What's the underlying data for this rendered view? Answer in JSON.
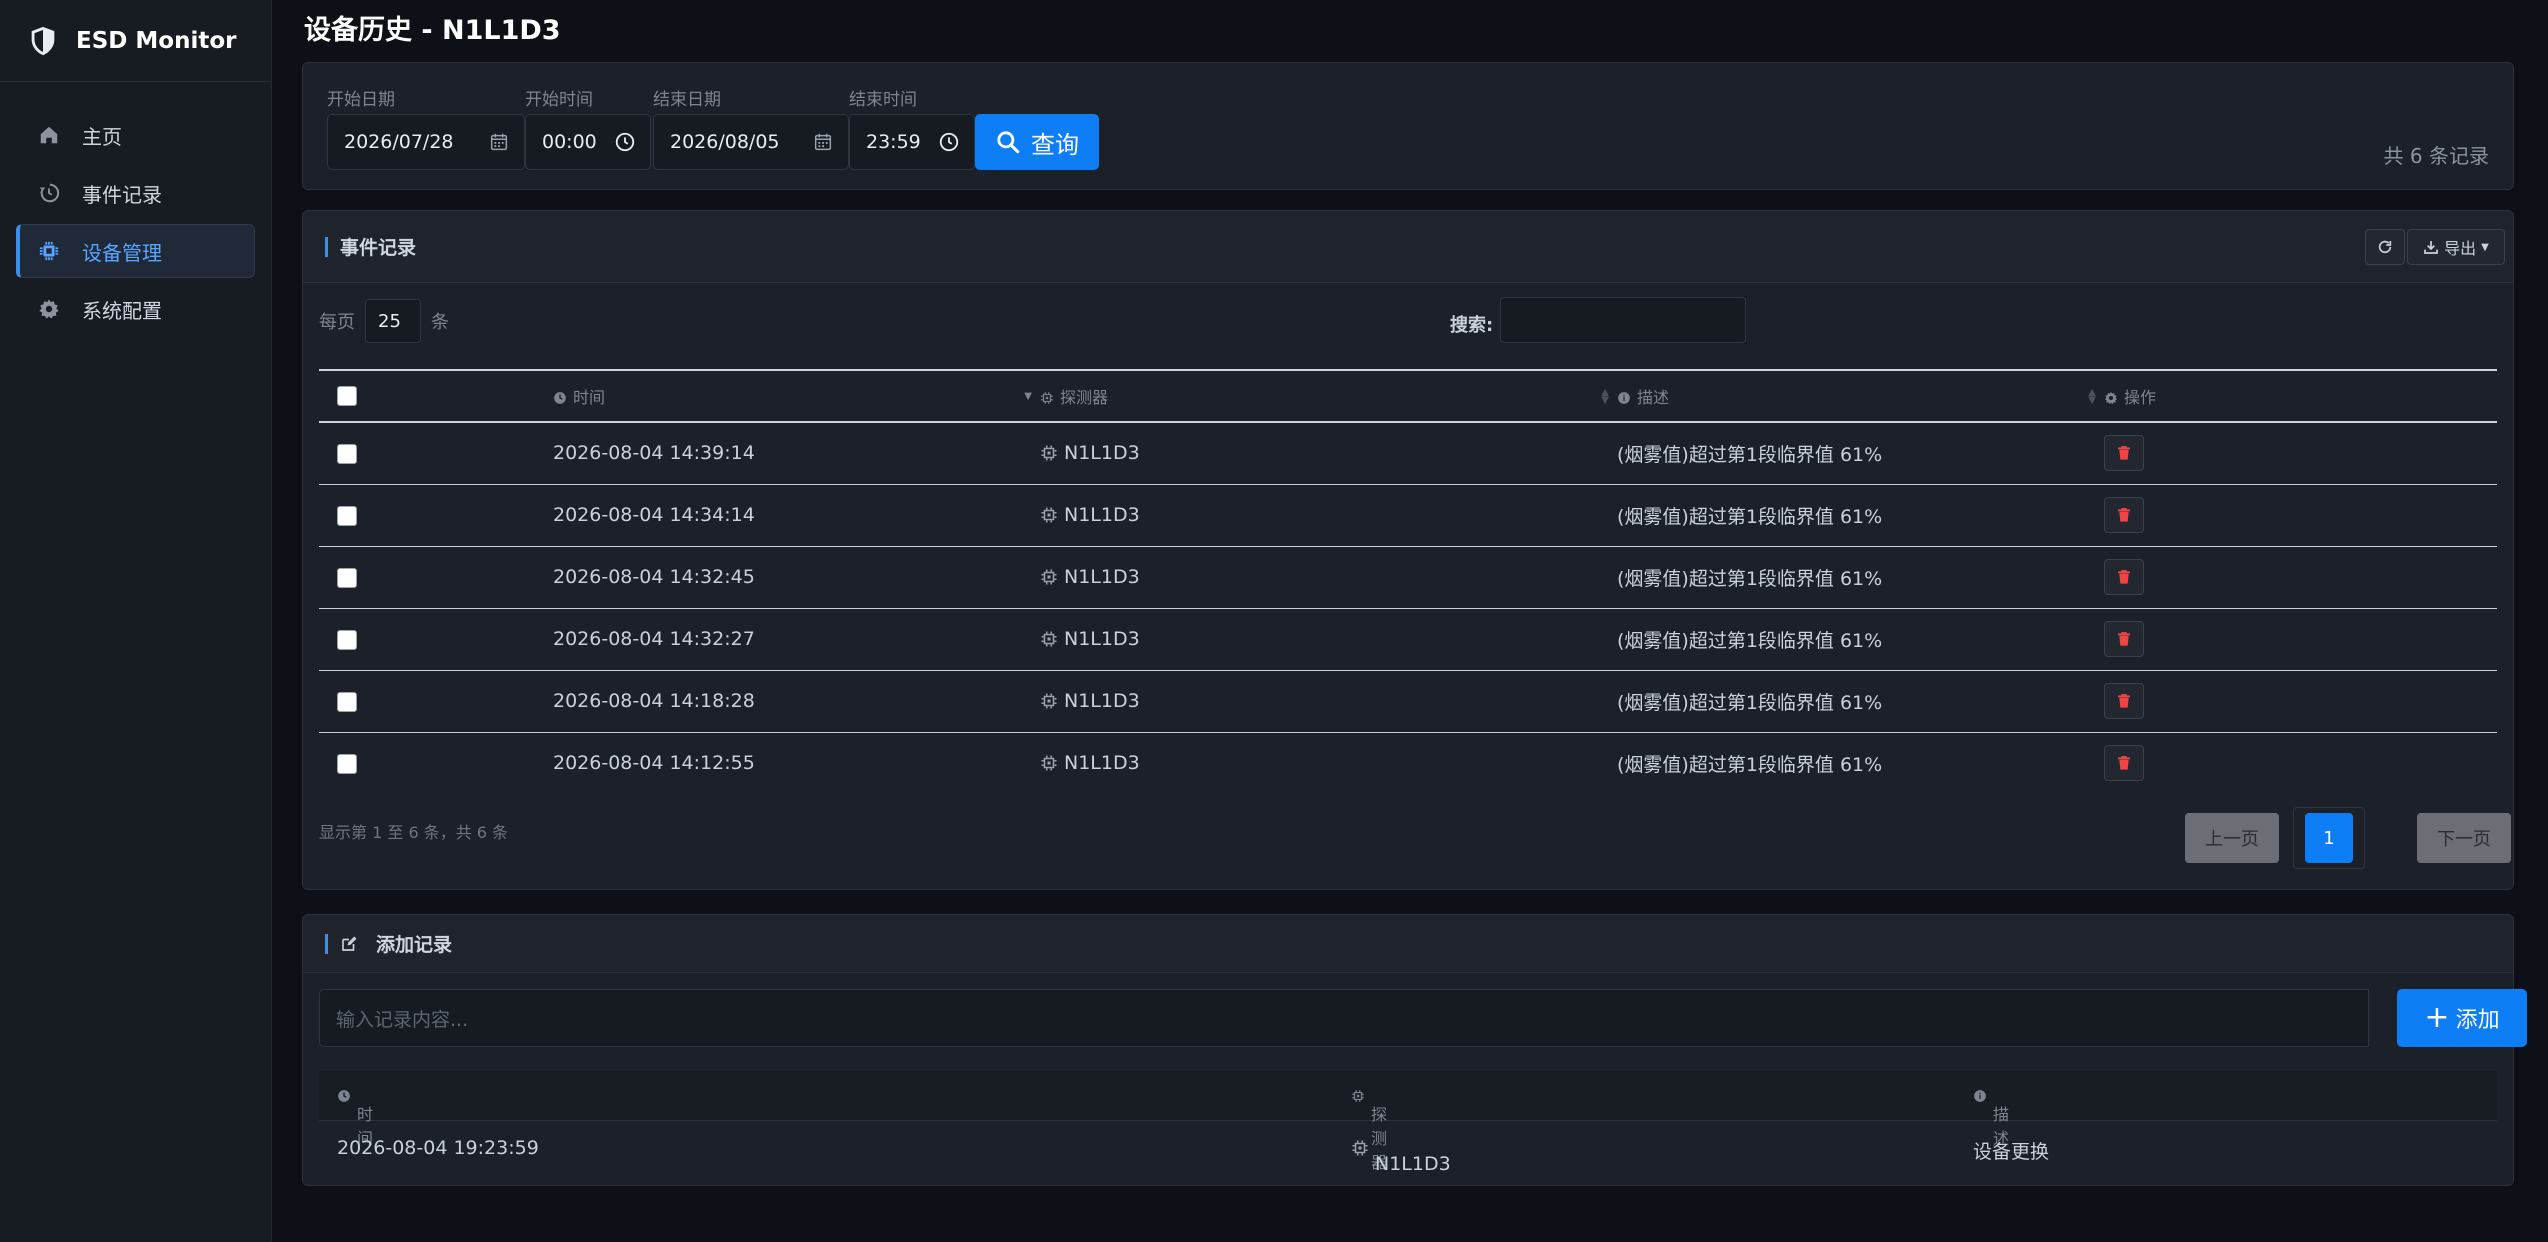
{
  "app": {
    "title": "ESD Monitor"
  },
  "nav": [
    {
      "label": "主页",
      "icon": "home-icon"
    },
    {
      "label": "事件记录",
      "icon": "history-icon"
    },
    {
      "label": "设备管理",
      "icon": "chip-icon",
      "active": true
    },
    {
      "label": "系统配置",
      "icon": "gear-icon"
    }
  ],
  "page": {
    "title": "设备历史 - N1L1D3"
  },
  "filter": {
    "start_date_label": "开始日期",
    "start_date": "2026/07/28",
    "start_time_label": "开始时间",
    "start_time": "00:00",
    "end_date_label": "结束日期",
    "end_date": "2026/08/05",
    "end_time_label": "结束时间",
    "end_time": "23:59",
    "query_label": "查询",
    "total_text": "共 6 条记录"
  },
  "events": {
    "title": "事件记录",
    "export_label": "导出",
    "per_page_prefix": "每页",
    "per_page_value": "25",
    "per_page_suffix": "条",
    "search_label": "搜索:",
    "columns": {
      "time": "时间",
      "detector": "探测器",
      "desc": "描述",
      "action": "操作"
    },
    "rows": [
      {
        "time": "2026-08-04 14:39:14",
        "detector": "N1L1D3",
        "desc": "(烟雾值)超过第1段临界值 61%"
      },
      {
        "time": "2026-08-04 14:34:14",
        "detector": "N1L1D3",
        "desc": "(烟雾值)超过第1段临界值 61%"
      },
      {
        "time": "2026-08-04 14:32:45",
        "detector": "N1L1D3",
        "desc": "(烟雾值)超过第1段临界值 61%"
      },
      {
        "time": "2026-08-04 14:32:27",
        "detector": "N1L1D3",
        "desc": "(烟雾值)超过第1段临界值 61%"
      },
      {
        "time": "2026-08-04 14:18:28",
        "detector": "N1L1D3",
        "desc": "(烟雾值)超过第1段临界值 61%"
      },
      {
        "time": "2026-08-04 14:12:55",
        "detector": "N1L1D3",
        "desc": "(烟雾值)超过第1段临界值 61%"
      }
    ],
    "info": "显示第 1 至 6 条，共 6 条",
    "prev_label": "上一页",
    "page_current": "1",
    "next_label": "下一页"
  },
  "add": {
    "title": "添加记录",
    "placeholder": "输入记录内容...",
    "add_label": "添加",
    "columns": {
      "time": "时间",
      "detector": "探测器",
      "desc": "描述"
    },
    "rows": [
      {
        "time": "2026-08-04 19:23:59",
        "detector": "N1L1D3",
        "desc": "设备更换"
      }
    ]
  },
  "colors": {
    "accent": "#0d7ef5",
    "danger": "#f04545",
    "bg": "#0d1117",
    "card": "#1c2028"
  }
}
